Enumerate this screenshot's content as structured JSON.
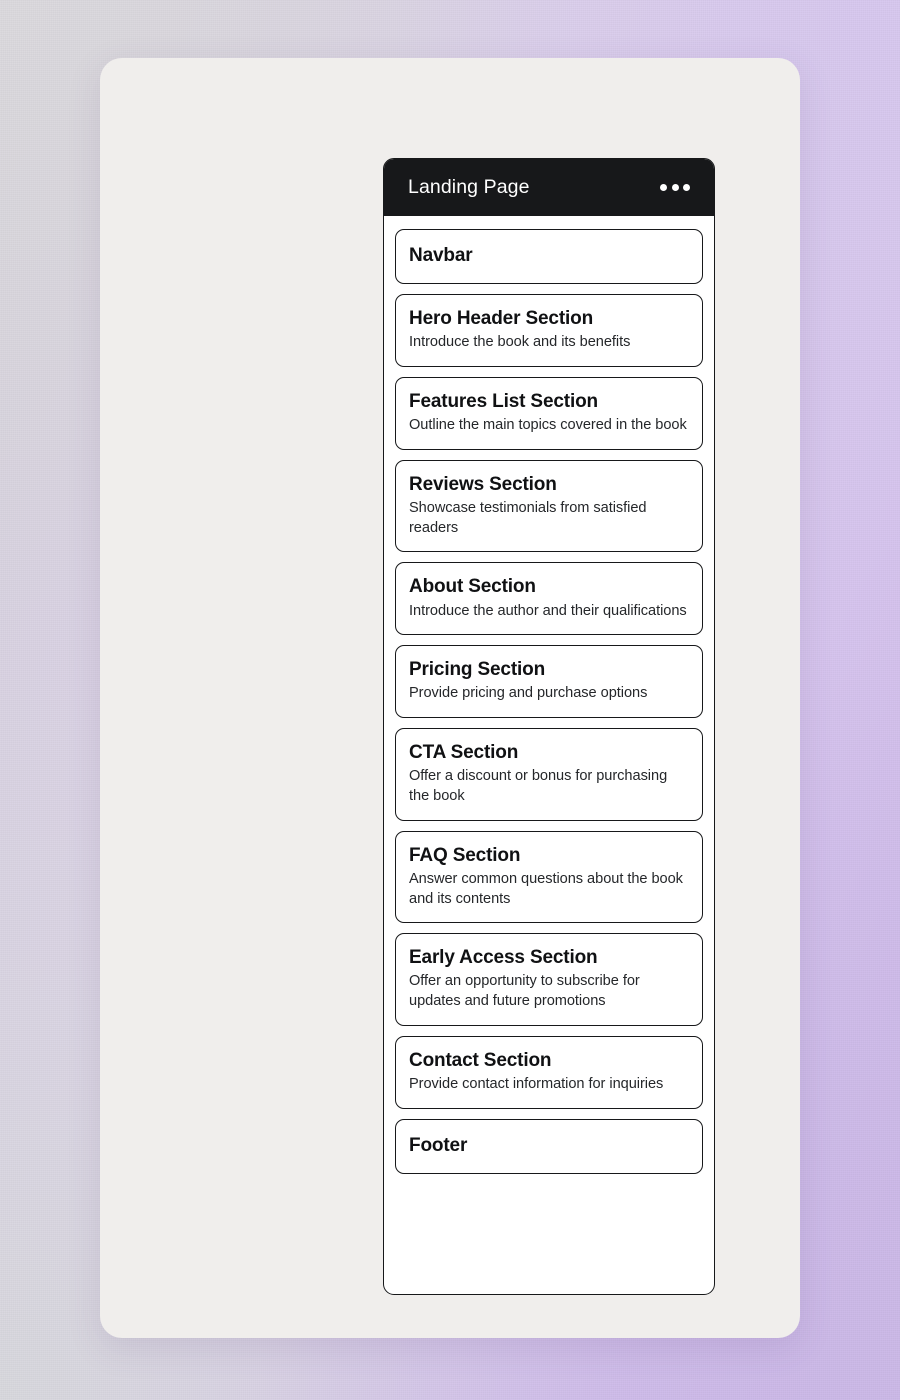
{
  "panel": {
    "title": "Landing Page",
    "overflow_menu": "•••",
    "sections": [
      {
        "title": "Navbar",
        "desc": ""
      },
      {
        "title": "Hero Header Section",
        "desc": "Introduce the book and its benefits"
      },
      {
        "title": "Features List Section",
        "desc": "Outline the main topics covered in the book"
      },
      {
        "title": "Reviews Section",
        "desc": "Showcase testimonials from satisfied readers"
      },
      {
        "title": "About Section",
        "desc": "Introduce the author and their qualifications"
      },
      {
        "title": "Pricing Section",
        "desc": "Provide pricing and purchase options"
      },
      {
        "title": "CTA Section",
        "desc": "Offer a discount or bonus for purchasing the book"
      },
      {
        "title": "FAQ Section",
        "desc": "Answer common questions about the book and its contents"
      },
      {
        "title": "Early Access Section",
        "desc": "Offer an opportunity to subscribe for updates and future promotions"
      },
      {
        "title": "Contact Section",
        "desc": "Provide contact information for inquiries"
      },
      {
        "title": "Footer",
        "desc": ""
      }
    ]
  },
  "colors": {
    "header_background": "#17181a",
    "header_text": "#ffffff",
    "panel_background": "#ffffff",
    "card_border": "#17181a",
    "card_title_text": "#101113",
    "card_desc_text": "#25272a",
    "outer_card_background": "#f0eeec",
    "backdrop_lavender": "#cdb8e9",
    "backdrop_grey": "#d6d4da"
  }
}
